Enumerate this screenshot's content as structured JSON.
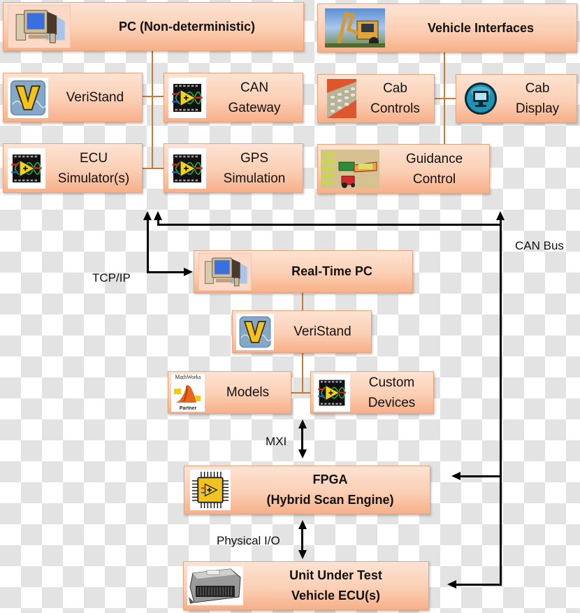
{
  "diagram": {
    "pc_group": {
      "header": {
        "label": "PC (Non-deterministic)",
        "icon": "desktop-computer-icon"
      },
      "items": [
        {
          "line1": "VeriStand",
          "line2": "",
          "icon": "veristand-logo-icon"
        },
        {
          "line1": "CAN",
          "line2": "Gateway",
          "icon": "labview-vi-icon"
        },
        {
          "line1": "ECU",
          "line2": "Simulator(s)",
          "icon": "labview-vi-icon"
        },
        {
          "line1": "GPS",
          "line2": "Simulation",
          "icon": "labview-vi-icon"
        }
      ]
    },
    "vehicle_group": {
      "header": {
        "label": "Vehicle Interfaces",
        "icon": "backhoe-photo-icon"
      },
      "items": [
        {
          "line1": "Cab",
          "line2": "Controls",
          "icon": "keypad-photo-icon"
        },
        {
          "line1": "Cab",
          "line2": "Display",
          "icon": "monitor-button-icon"
        },
        {
          "line1": "Guidance",
          "line2": "Control",
          "icon": "harvester-illustration-icon"
        }
      ]
    },
    "realtime_group": {
      "header": {
        "label": "Real-Time PC",
        "icon": "desktop-computer-icon"
      },
      "veristand": {
        "label": "VeriStand",
        "icon": "veristand-logo-icon"
      },
      "models": {
        "label": "Models",
        "icon": "mathworks-partner-icon",
        "icon_top_text": "MathWorks",
        "icon_bottom_text": "Partner"
      },
      "custom_devices": {
        "line1": "Custom",
        "line2": "Devices",
        "icon": "labview-vi-icon"
      }
    },
    "fpga": {
      "line1": "FPGA",
      "line2": "(Hybrid Scan Engine)",
      "icon": "fpga-chip-icon"
    },
    "uut": {
      "line1": "Unit Under Test",
      "line2": "Vehicle ECU(s)",
      "icon": "ecu-module-photo-icon"
    },
    "annotations": {
      "tcpip": "TCP/IP",
      "can_bus": "CAN Bus",
      "mxi": "MXI",
      "physical_io": "Physical I/O"
    },
    "colors": {
      "box_top": "#fde3d3",
      "box_bottom": "#f7b089",
      "box_border": "#e6a57e",
      "connector": "#c97a2f",
      "arrow": "#000000"
    }
  }
}
